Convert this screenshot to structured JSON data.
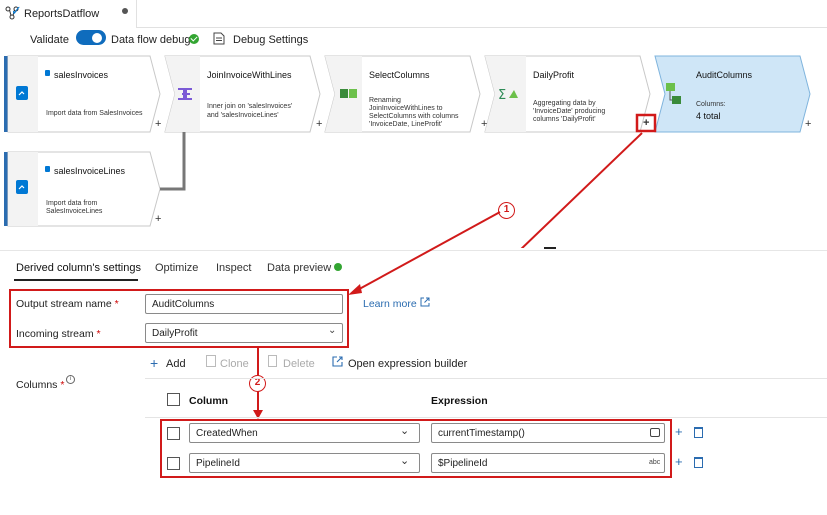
{
  "tab": {
    "title": "ReportsDatflow"
  },
  "toolbar": {
    "validate": "Validate",
    "debug_label": "Data flow debug",
    "debug_settings": "Debug Settings"
  },
  "nodes": [
    {
      "title": "salesInvoices",
      "body": [
        "Import data from SalesInvoices"
      ]
    },
    {
      "title": "JoinInvoiceWithLines",
      "body": [
        "Inner join on 'salesInvoices'",
        "and 'salesInvoiceLines'"
      ]
    },
    {
      "title": "SelectColumns",
      "body": [
        "Renaming",
        "JoinInvoiceWithLines to",
        "SelectColumns with columns",
        "'InvoiceDate, LineProfit'"
      ]
    },
    {
      "title": "DailyProfit",
      "body": [
        "Aggregating data by",
        "'InvoiceDate' producing",
        "columns 'DailyProfit'"
      ]
    },
    {
      "title": "AuditColumns",
      "columns_label": "Columns:",
      "columns_value": "4 total"
    },
    {
      "title": "salesInvoiceLines",
      "body": [
        "Import data from",
        "SalesInvoiceLines"
      ]
    }
  ],
  "plus": "+",
  "callouts": {
    "one": "1",
    "two": "2"
  },
  "panel": {
    "tabs": [
      "Derived column's settings",
      "Optimize",
      "Inspect",
      "Data preview"
    ],
    "output_label": "Output stream name",
    "output_value": "AuditColumns",
    "incoming_label": "Incoming stream",
    "incoming_value": "DailyProfit",
    "required_mark": "*",
    "learn_more": "Learn more",
    "columns_label": "Columns",
    "actions": {
      "add": "Add",
      "clone": "Clone",
      "delete": "Delete",
      "expr": "Open expression builder"
    },
    "headers": {
      "column": "Column",
      "expression": "Expression"
    },
    "rows": [
      {
        "column": "CreatedWhen",
        "expression": "currentTimestamp()"
      },
      {
        "column": "PipelineId",
        "expression": "$PipelineId",
        "type": "abc"
      }
    ]
  },
  "colors": {
    "accent": "#0f6cbd",
    "callout": "#d11a1a",
    "selected_node": "#cfe6f7",
    "success": "#33a532"
  }
}
